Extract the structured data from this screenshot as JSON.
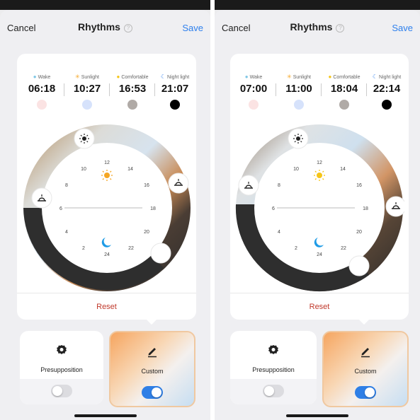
{
  "screens": [
    {
      "header": {
        "cancel": "Cancel",
        "title": "Rhythms",
        "help": "?",
        "save": "Save"
      },
      "times": [
        {
          "label": "Wake",
          "value": "06:18",
          "dot_color": "#7fc7e6",
          "swatch": "#fbe3e3"
        },
        {
          "label": "Sunlight",
          "value": "10:27",
          "dot_color": "#f5a623",
          "swatch": "#d6e2fb"
        },
        {
          "label": "Comfortable",
          "value": "16:53",
          "dot_color": "#f5c518",
          "swatch": "#b0aaa6"
        },
        {
          "label": "Night light",
          "value": "21:07",
          "dot_color": "#2f80ed",
          "swatch": "#000000"
        }
      ],
      "hours": [
        "12",
        "14",
        "16",
        "18",
        "20",
        "22",
        "24",
        "2",
        "4",
        "6",
        "8",
        "10"
      ],
      "reset": "Reset",
      "options": [
        {
          "label": "Presupposition",
          "enabled": false
        },
        {
          "label": "Custom",
          "enabled": true
        }
      ]
    },
    {
      "header": {
        "cancel": "Cancel",
        "title": "Rhythms",
        "help": "?",
        "save": "Save"
      },
      "times": [
        {
          "label": "Wake",
          "value": "07:00",
          "dot_color": "#7fc7e6",
          "swatch": "#fbe3e3"
        },
        {
          "label": "Sunlight",
          "value": "11:00",
          "dot_color": "#f5a623",
          "swatch": "#d6e2fb"
        },
        {
          "label": "Comfortable",
          "value": "18:04",
          "dot_color": "#f5c518",
          "swatch": "#b0aaa6"
        },
        {
          "label": "Night light",
          "value": "22:14",
          "dot_color": "#2f80ed",
          "swatch": "#000000"
        }
      ],
      "hours": [
        "12",
        "14",
        "16",
        "18",
        "20",
        "22",
        "24",
        "2",
        "4",
        "6",
        "8",
        "10"
      ],
      "reset": "Reset",
      "options": [
        {
          "label": "Presupposition",
          "enabled": false
        },
        {
          "label": "Custom",
          "enabled": true
        }
      ]
    }
  ]
}
